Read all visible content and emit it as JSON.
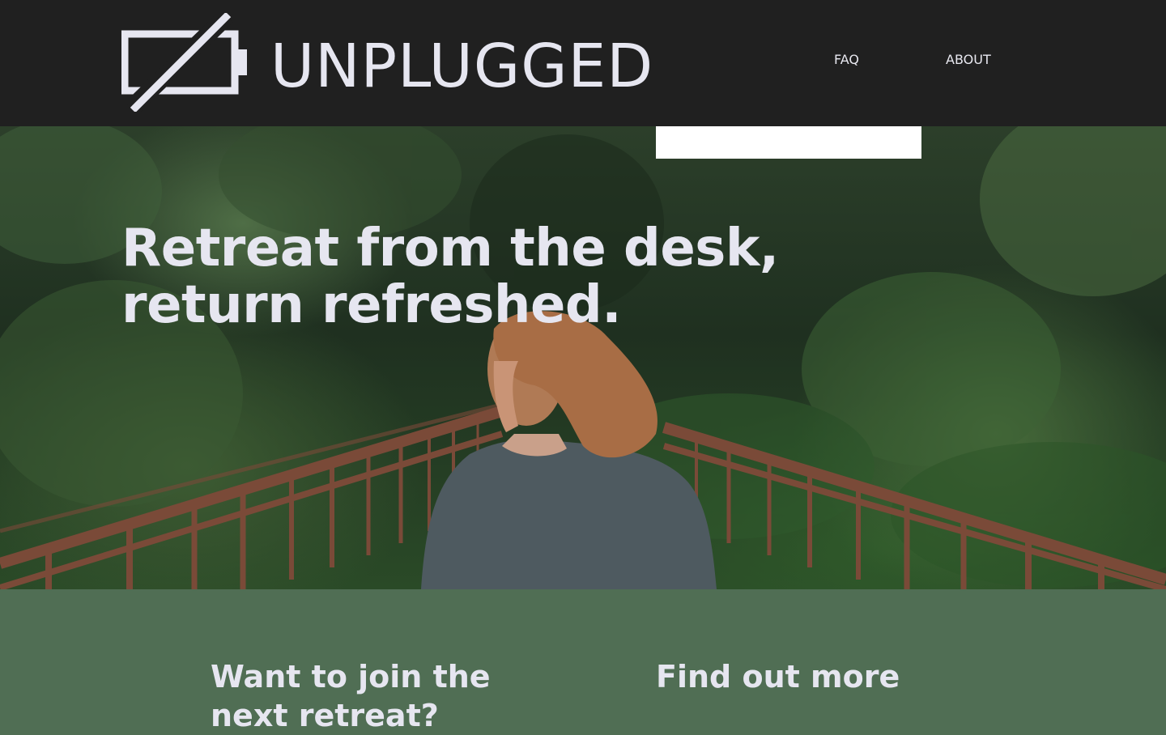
{
  "header": {
    "logo_text": "UNPLUGGED",
    "logo_icon": "battery-slash-icon",
    "nav": [
      {
        "label": "FAQ"
      },
      {
        "label": "ABOUT"
      }
    ]
  },
  "hero": {
    "title_line1": "Retreat from the desk,",
    "title_line2": "return refreshed."
  },
  "cta": {
    "join_line1": "Want to join the",
    "join_line2": "next retreat?",
    "find_out_more": "Find out more"
  },
  "colors": {
    "header_bg": "#202020",
    "text": "#e6e6f0",
    "cta_bg": "#506e54"
  }
}
